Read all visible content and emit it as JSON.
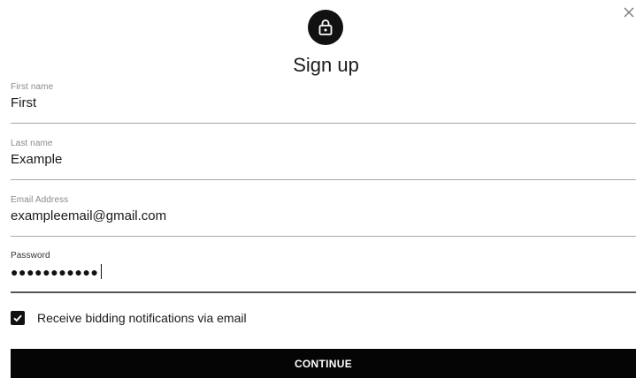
{
  "dialog": {
    "title": "Sign up"
  },
  "fields": {
    "first_name": {
      "label": "First name",
      "value": "First"
    },
    "last_name": {
      "label": "Last name",
      "value": "Example"
    },
    "email": {
      "label": "Email Address",
      "value": "exampleemail@gmail.com"
    },
    "password": {
      "label": "Password",
      "value": "●●●●●●●●●●●"
    }
  },
  "options": {
    "notifications_label": "Receive bidding notifications via email",
    "notifications_checked": true
  },
  "actions": {
    "continue_label": "CONTINUE"
  },
  "icons": {
    "close": "close-icon",
    "lock": "lock-icon",
    "check": "check-icon"
  },
  "colors": {
    "primary": "#111111",
    "background": "#ffffff",
    "underline": "#a8a8a8"
  }
}
